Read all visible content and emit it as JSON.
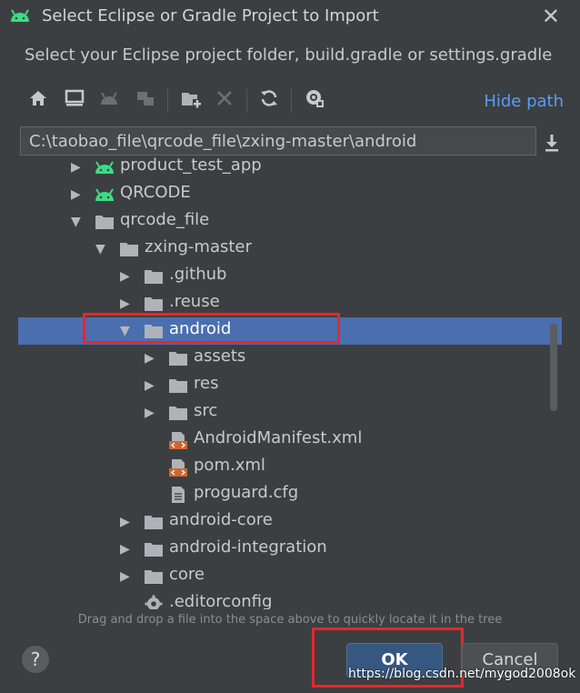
{
  "dialog": {
    "title": "Select Eclipse or Gradle Project to Import",
    "subtitle": "Select your Eclipse project folder, build.gradle or settings.gradle",
    "close_label": "✕"
  },
  "toolbar": {
    "icons": [
      "home-icon",
      "desktop-icon",
      "android-icon",
      "module-icon",
      "new-folder-icon",
      "delete-icon",
      "refresh-icon",
      "show-hidden-icon"
    ],
    "hide_path_label": "Hide path"
  },
  "path": {
    "value": "C:\\taobao_file\\qrcode_file\\zxing-master\\android"
  },
  "tree": {
    "rows": [
      {
        "label": "product_test_app",
        "kind": "android",
        "expanded": false,
        "selected": false
      },
      {
        "label": "QRCODE",
        "kind": "android",
        "expanded": false,
        "selected": false
      },
      {
        "label": "qrcode_file",
        "kind": "folder",
        "expanded": true,
        "selected": false
      },
      {
        "label": "zxing-master",
        "kind": "folder",
        "expanded": true,
        "selected": false
      },
      {
        "label": ".github",
        "kind": "folder",
        "expanded": false,
        "selected": false
      },
      {
        "label": ".reuse",
        "kind": "folder",
        "expanded": false,
        "selected": false
      },
      {
        "label": "android",
        "kind": "folder",
        "expanded": true,
        "selected": true
      },
      {
        "label": "assets",
        "kind": "folder",
        "expanded": false,
        "selected": false
      },
      {
        "label": "res",
        "kind": "folder",
        "expanded": false,
        "selected": false
      },
      {
        "label": "src",
        "kind": "folder",
        "expanded": false,
        "selected": false
      },
      {
        "label": "AndroidManifest.xml",
        "kind": "xml",
        "expanded": null,
        "selected": false
      },
      {
        "label": "pom.xml",
        "kind": "xml",
        "expanded": null,
        "selected": false
      },
      {
        "label": "proguard.cfg",
        "kind": "file",
        "expanded": null,
        "selected": false
      },
      {
        "label": "android-core",
        "kind": "folder",
        "expanded": false,
        "selected": false
      },
      {
        "label": "android-integration",
        "kind": "folder",
        "expanded": false,
        "selected": false
      },
      {
        "label": "core",
        "kind": "folder",
        "expanded": false,
        "selected": false
      },
      {
        "label": ".editorconfig",
        "kind": "config",
        "expanded": null,
        "selected": false
      }
    ]
  },
  "hint": "Drag and drop a file into the space above to quickly locate it in the tree",
  "buttons": {
    "help_label": "?",
    "ok_label": "OK",
    "cancel_label": "Cancel"
  },
  "watermark": "https://blog.csdn.net/mygod2008ok",
  "colors": {
    "background": "#3c3f41",
    "selection": "#4b6eaf",
    "link": "#589df6",
    "highlight": "#e8262c",
    "android_green": "#3ddc84"
  }
}
